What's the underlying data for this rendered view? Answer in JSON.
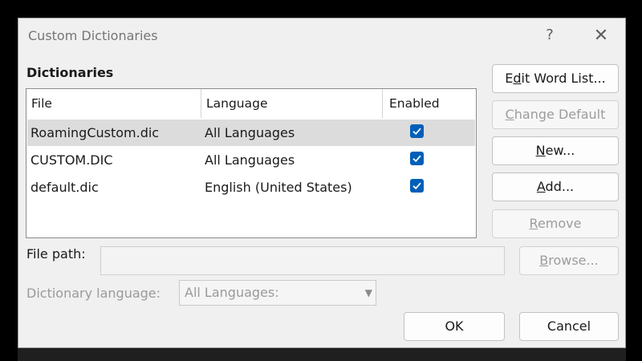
{
  "dialog": {
    "title": "Custom Dictionaries",
    "help": "?",
    "close": "✕"
  },
  "group_label": "Dictionaries",
  "columns": {
    "file": "File",
    "language": "Language",
    "enabled": "Enabled"
  },
  "rows": [
    {
      "file": "RoamingCustom.dic",
      "language": "All Languages",
      "enabled": true,
      "selected": true
    },
    {
      "file": "CUSTOM.DIC",
      "language": "All Languages",
      "enabled": true,
      "selected": false
    },
    {
      "file": "default.dic",
      "language": "English (United States)",
      "enabled": true,
      "selected": false
    }
  ],
  "buttons": {
    "edit_word_list": {
      "pre": "E",
      "key": "d",
      "post": "it Word List..."
    },
    "change_default": {
      "pre": "",
      "key": "C",
      "post": "hange Default"
    },
    "new": {
      "pre": "",
      "key": "N",
      "post": "ew..."
    },
    "add": {
      "pre": "",
      "key": "A",
      "post": "dd..."
    },
    "remove": {
      "pre": "",
      "key": "R",
      "post": "emove"
    },
    "browse": {
      "pre": "",
      "key": "B",
      "post": "rowse..."
    },
    "ok": "OK",
    "cancel": "Cancel"
  },
  "file_path": {
    "label": "File path:",
    "value": ""
  },
  "dictionary_language": {
    "label": "Dictionary language:",
    "value": "All Languages:"
  },
  "colors": {
    "accent": "#005fb8",
    "selected_row": "#dcdcdc",
    "disabled_text": "#9c9c9c"
  }
}
